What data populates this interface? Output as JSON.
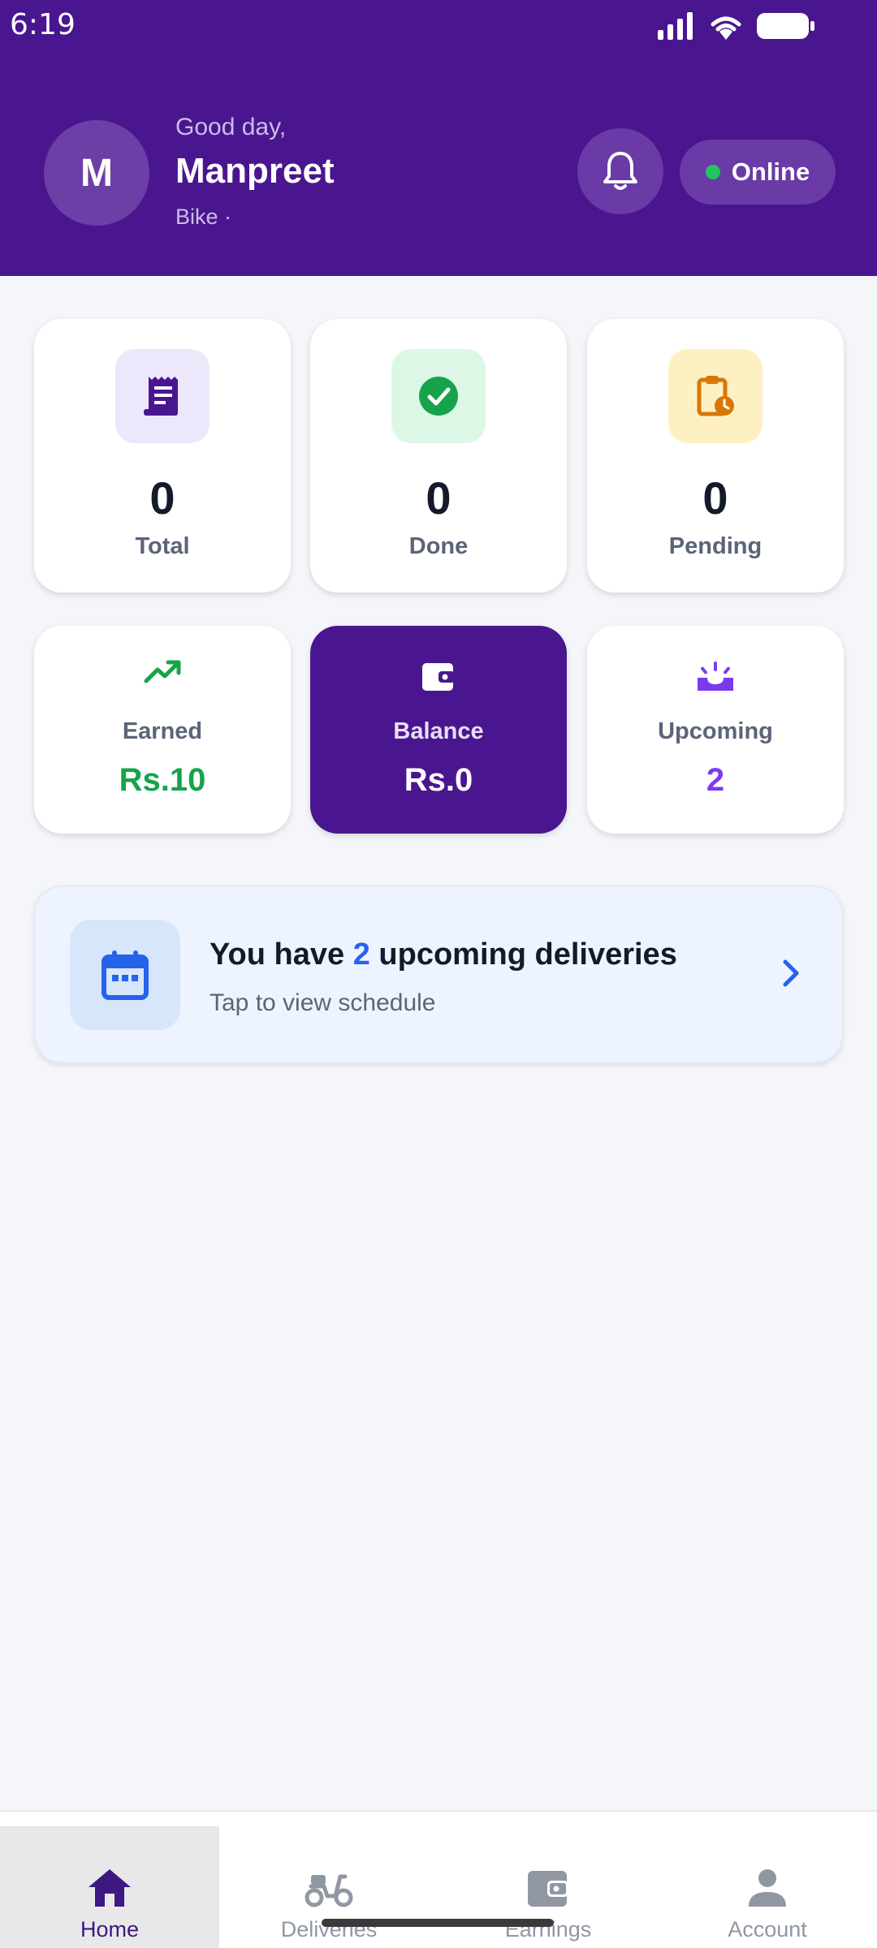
{
  "status_bar": {
    "time": "6:19"
  },
  "header": {
    "avatar_initial": "M",
    "greeting": "Good day,",
    "name": "Manpreet",
    "vehicle": "Bike ·",
    "status_label": "Online",
    "status_color": "#22c55e",
    "brand_color": "#4a168f"
  },
  "stats": [
    {
      "icon": "receipt-icon",
      "value": "0",
      "label": "Total"
    },
    {
      "icon": "check-circle-icon",
      "value": "0",
      "label": "Done"
    },
    {
      "icon": "clipboard-clock-icon",
      "value": "0",
      "label": "Pending"
    }
  ],
  "money": [
    {
      "icon": "trending-up-icon",
      "label": "Earned",
      "value": "Rs.10",
      "color": "#16a34a"
    },
    {
      "icon": "wallet-icon",
      "label": "Balance",
      "value": "Rs.0",
      "color": "#ffffff"
    },
    {
      "icon": "upcoming-icon",
      "label": "Upcoming",
      "value": "2",
      "color": "#7c3aed"
    }
  ],
  "banner": {
    "title_prefix": "You have",
    "count": "2",
    "title_suffix": "upcoming deliveries",
    "subtitle": "Tap to view schedule"
  },
  "bottom_nav": [
    {
      "label": "Home",
      "icon": "home-icon",
      "active": true
    },
    {
      "label": "Deliveries",
      "icon": "scooter-icon",
      "active": false
    },
    {
      "label": "Earnings",
      "icon": "wallet-icon",
      "active": false
    },
    {
      "label": "Account",
      "icon": "person-icon",
      "active": false
    }
  ]
}
